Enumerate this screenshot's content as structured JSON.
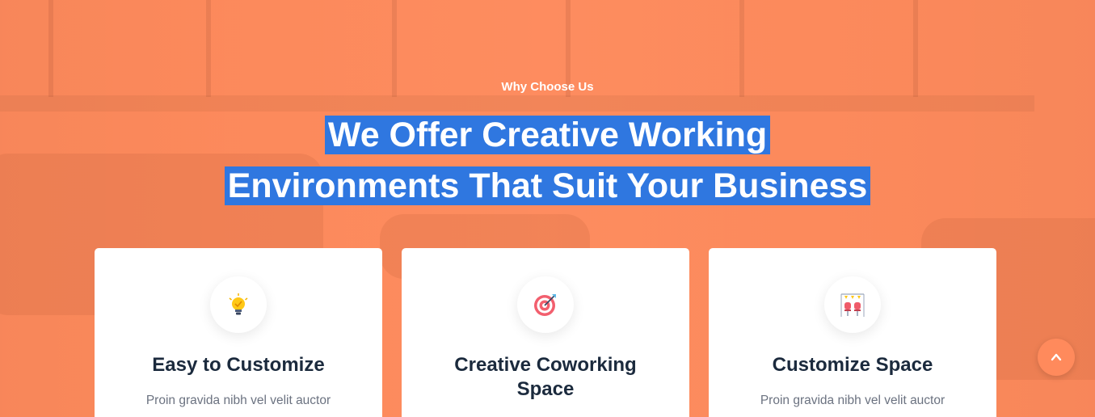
{
  "section": {
    "eyebrow": "Why Choose Us",
    "headline_line1": "We Offer Creative Working",
    "headline_line2": "Environments That Suit Your Business"
  },
  "features": [
    {
      "icon": "lightbulb-icon",
      "title": "Easy to Customize",
      "text": "Proin gravida nibh vel velit auctor"
    },
    {
      "icon": "target-icon",
      "title_line1": "Creative Coworking",
      "title_line2": "Space"
    },
    {
      "icon": "chairs-icon",
      "title": "Customize Space",
      "text": "Proin gravida nibh vel velit auctor"
    }
  ],
  "colors": {
    "overlay": "#ff8a5c",
    "selection": "#2f77e0",
    "heading": "#1b2a3d",
    "body_text": "#6b7280"
  },
  "scroll_top": {
    "icon": "chevron-up-icon"
  }
}
